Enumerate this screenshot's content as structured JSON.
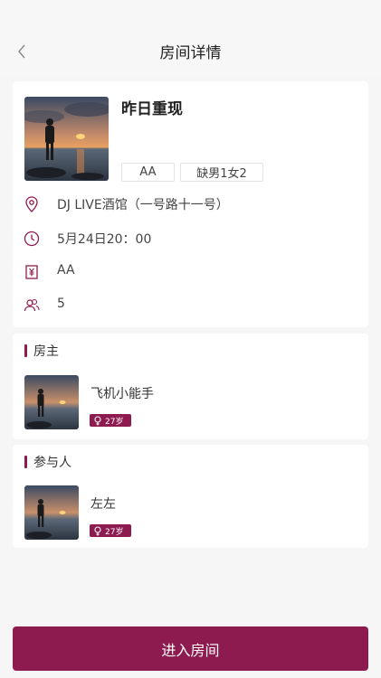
{
  "nav": {
    "back_icon": "chevron-left-icon",
    "title": "房间详情"
  },
  "room": {
    "name": "昨日重现",
    "tags": [
      "AA",
      "缺男1女2"
    ],
    "location": "DJ LIVE酒馆（一号路十一号）",
    "time": "5月24日20：00",
    "payment": "AA",
    "people": "5"
  },
  "host": {
    "section_title": "房主",
    "name": "飞机小能手",
    "age": "27岁"
  },
  "members": {
    "section_title": "参与人",
    "list": [
      {
        "name": "左左",
        "age": "27岁"
      }
    ]
  },
  "actions": {
    "enter_label": "进入房间"
  },
  "colors": {
    "accent": "#8e1b4f",
    "background": "#f6f6f6",
    "card": "#ffffff"
  }
}
